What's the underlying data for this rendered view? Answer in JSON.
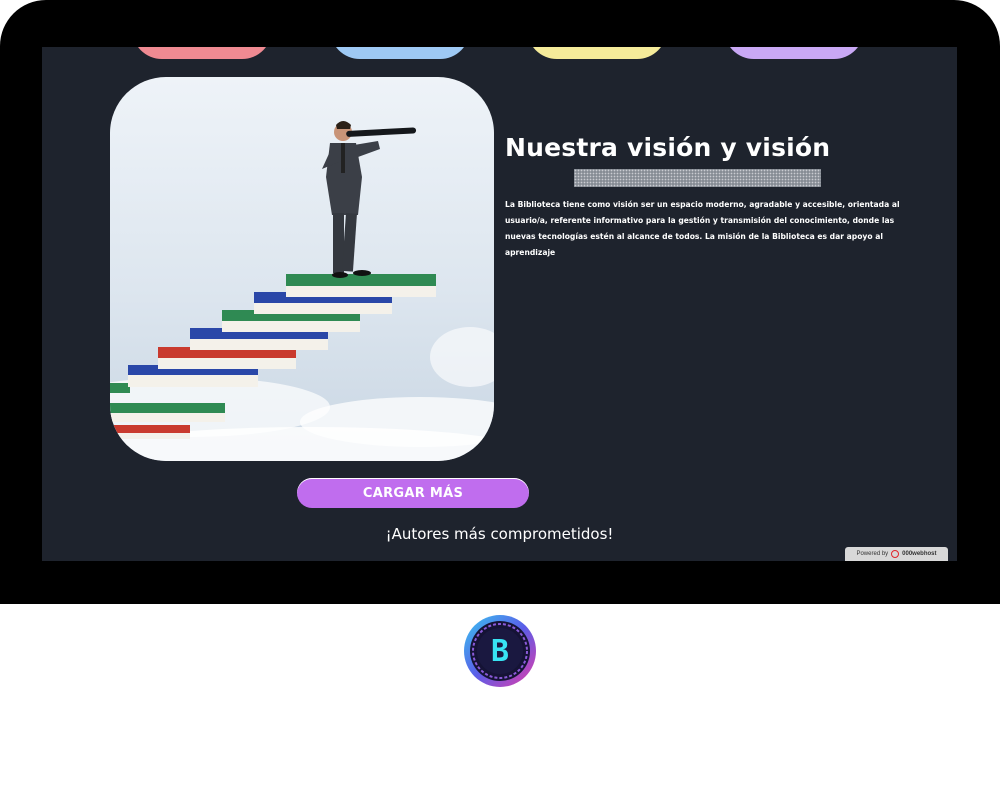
{
  "vision": {
    "title": "Nuestra visión y visión",
    "description": "La Biblioteca tiene como visión ser un espacio moderno, agradable y accesible, orientada al usuario/a, referente informativo para la gestión y transmisión del conocimiento, donde las nuevas tecnologías estén al alcance de todos. La misión de la Biblioteca es dar apoyo al aprendizaje",
    "image_icon": "man-with-telescope-on-book-stairs-image"
  },
  "actions": {
    "load_more_label": "CARGAR MÁS"
  },
  "authors": {
    "heading": "¡Autores más comprometidos!"
  },
  "footer": {
    "powered_by": "Powered by",
    "host_name": "000webhost"
  },
  "badge": {
    "letter": "B"
  },
  "colors": {
    "page_bg": "#1e232d",
    "accent_button": "#c06dee",
    "pill_red": "#ef8a92",
    "pill_blue": "#9ec9f4",
    "pill_yellow": "#f5eb9a",
    "pill_purple": "#c9a8f5"
  }
}
